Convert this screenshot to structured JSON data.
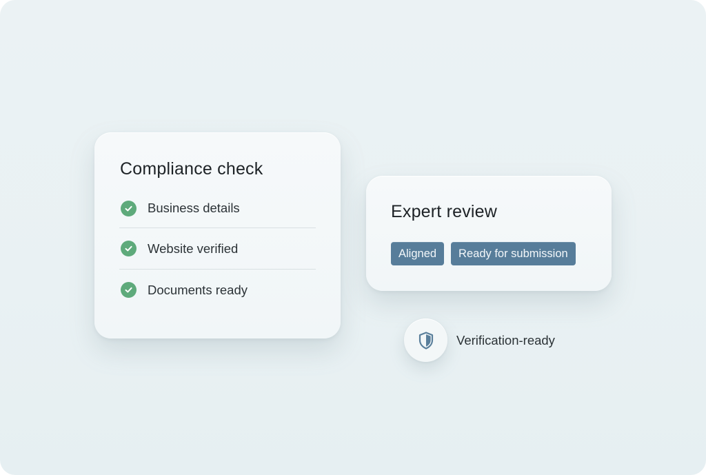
{
  "compliance": {
    "title": "Compliance check",
    "items": [
      {
        "label": "Business details",
        "icon": "check-circle-icon",
        "status": "done"
      },
      {
        "label": "Website verified",
        "icon": "check-circle-icon",
        "status": "done"
      },
      {
        "label": "Documents ready",
        "icon": "check-circle-icon",
        "status": "done"
      }
    ]
  },
  "review": {
    "title": "Expert review",
    "tags": [
      "Aligned",
      "Ready for submission"
    ]
  },
  "badge": {
    "icon": "shield-icon",
    "label": "Verification-ready"
  },
  "colors": {
    "check_green": "#5eaa7b",
    "tag_blue": "#577d9a",
    "shield_blue": "#5a7f9b",
    "background": "#ebf2f4"
  }
}
